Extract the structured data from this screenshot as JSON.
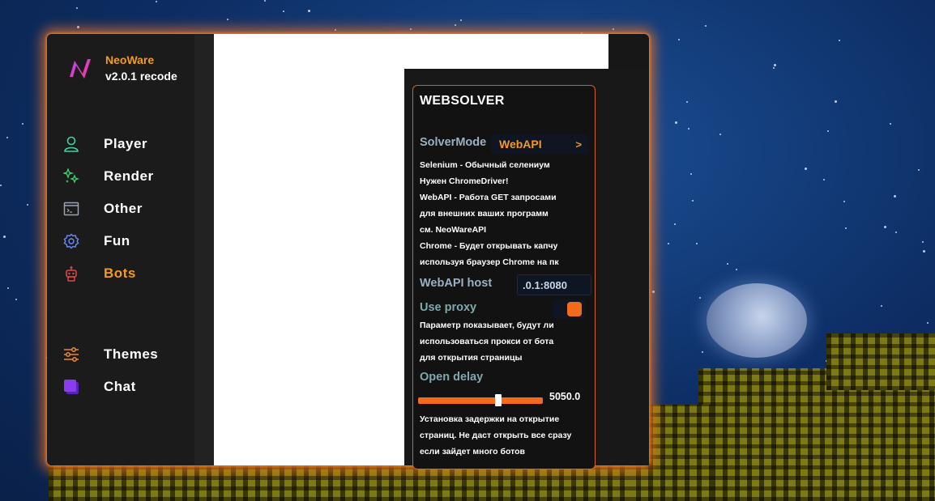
{
  "brand": {
    "name": "NeoWare",
    "version": "v2.0.1 recode"
  },
  "nav": [
    {
      "label": "Player",
      "icon": "user-icon",
      "color": "#3fd3a0",
      "active": false
    },
    {
      "label": "Render",
      "icon": "sparkles-icon",
      "color": "#3fd36a",
      "active": false
    },
    {
      "label": "Other",
      "icon": "terminal-window-icon",
      "color": "#9aa3b0",
      "active": false
    },
    {
      "label": "Fun",
      "icon": "gear-icon",
      "color": "#6b8cff",
      "active": false
    },
    {
      "label": "Bots",
      "icon": "robot-icon",
      "color": "#e04848",
      "active": true
    },
    {
      "label": "Themes",
      "icon": "sliders-icon",
      "color": "#f08a2a",
      "active": false
    },
    {
      "label": "Chat",
      "icon": "chat-bubbles-icon",
      "color": "#8a3cf0",
      "active": false
    }
  ],
  "colors": {
    "accent": "#f29b1f",
    "glow": "#ff7a1e",
    "toggle_on": "#f36a1c"
  },
  "panel": {
    "title": "WEBSOLVER",
    "solver_mode": {
      "label": "SolverMode",
      "value": "WebAPI",
      "arrow": ">"
    },
    "solver_desc": [
      "Selenium - Обычный селениум",
      "Нужен ChromeDriver!",
      "WebAPI - Работа GET запросами",
      "для внешних ваших программ",
      "см. NeoWareAPI",
      "Chrome - Будет открывать капчу",
      "используя браузер Chrome на пк"
    ],
    "webapi_host": {
      "label": "WebAPI host",
      "value": ".0.1:8080"
    },
    "use_proxy": {
      "label": "Use proxy",
      "enabled": true
    },
    "proxy_desc": [
      "Параметр показывает, будут ли",
      "использоваться прокси от бота",
      "для открытия страницы"
    ],
    "open_delay": {
      "label": "Open delay",
      "value_text": "5050.0",
      "fraction": 0.64
    },
    "delay_desc": [
      "Установка задержки на открытие",
      "страниц. Не даст открыть все сразу",
      "если зайдет много ботов"
    ]
  }
}
